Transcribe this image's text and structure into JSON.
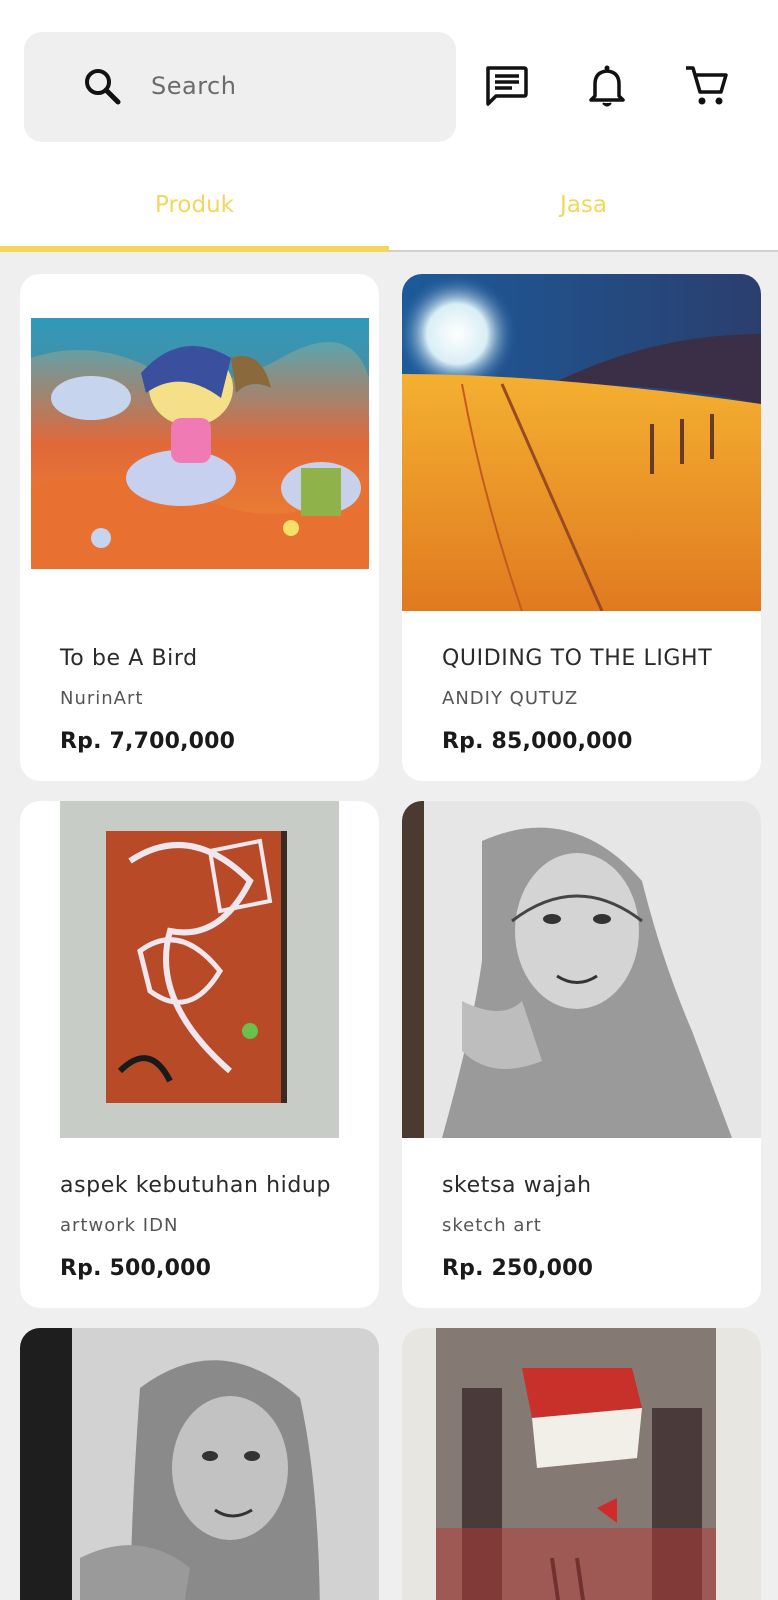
{
  "search": {
    "placeholder": "Search",
    "icon": "search-icon"
  },
  "header_icons": [
    {
      "name": "chat-icon"
    },
    {
      "name": "bell-icon"
    },
    {
      "name": "cart-icon"
    }
  ],
  "tabs": [
    {
      "label": "Produk",
      "active": true
    },
    {
      "label": "Jasa",
      "active": false
    }
  ],
  "colors": {
    "accent": "#f3d75b",
    "background": "#efefef",
    "card": "#ffffff"
  },
  "products": [
    {
      "title": "To be A Bird",
      "seller": "NurinArt",
      "price": "Rp. 7,700,000"
    },
    {
      "title": "QUIDING TO THE LIGHT",
      "seller": "ANDIY QUTUZ",
      "price": "Rp. 85,000,000"
    },
    {
      "title": "aspek kebutuhan hidup",
      "seller": "artwork IDN",
      "price": "Rp. 500,000"
    },
    {
      "title": "sketsa wajah",
      "seller": "sketch art",
      "price": "Rp. 250,000"
    },
    {
      "title": "",
      "seller": "",
      "price": ""
    },
    {
      "title": "",
      "seller": "",
      "price": ""
    }
  ]
}
